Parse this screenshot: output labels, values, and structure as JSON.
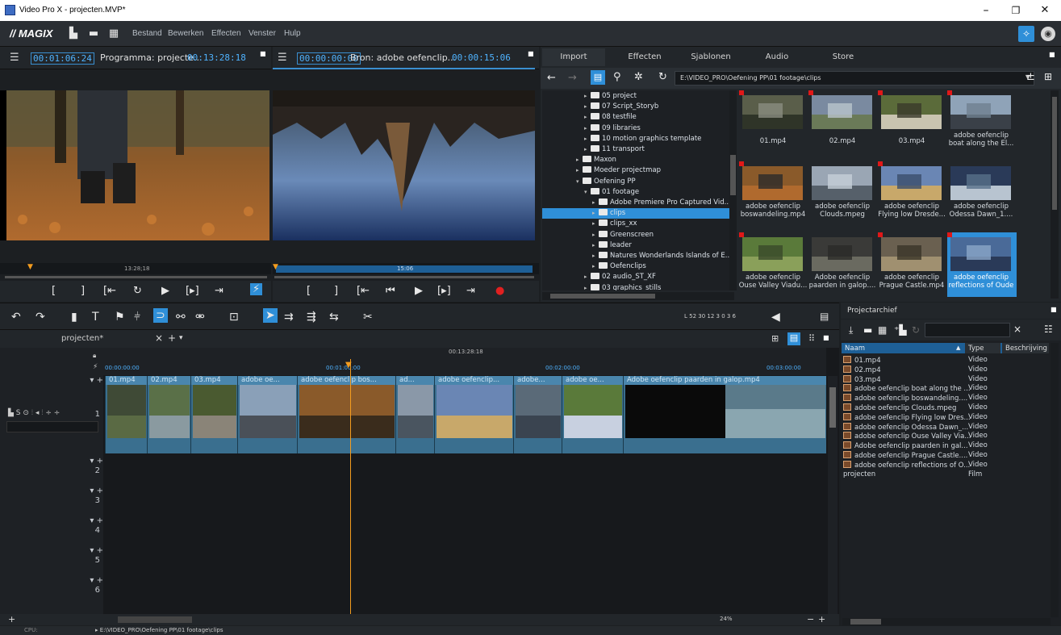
{
  "window": {
    "title": "Video Pro X - projecten.MVP*",
    "minimize": "–",
    "maximize": "❐",
    "close": "✕"
  },
  "menubar": {
    "logo": "// MAGIX",
    "items": [
      "Bestand",
      "Bewerken",
      "Effecten",
      "Venster",
      "Hulp"
    ]
  },
  "program_monitor": {
    "timecode_left": "00:01:06:24",
    "title": "Programma: projecte...",
    "timecode_right": "00:13:28:18",
    "ruler_label": "13:28;18"
  },
  "source_monitor": {
    "timecode_left": "00:00:00:00",
    "title": "Bron: adobe oefenclip...",
    "timecode_right": "00:00:15:06",
    "ruler_label": "15:06"
  },
  "media_tabs": [
    "Import",
    "Effecten",
    "Sjablonen",
    "Audio",
    "Store"
  ],
  "media_path": "E:\\VIDEO_PRO\\Oefening PP\\01 footage\\clips",
  "folder_tree": [
    {
      "label": "05 project",
      "indent": 4
    },
    {
      "label": "07 Script_Storyb",
      "indent": 4
    },
    {
      "label": "08 testfile",
      "indent": 4
    },
    {
      "label": "09 libraries",
      "indent": 4
    },
    {
      "label": "10 motion graphics template",
      "indent": 4
    },
    {
      "label": "11 transport",
      "indent": 4
    },
    {
      "label": "Maxon",
      "indent": 3
    },
    {
      "label": "Moeder projectmap",
      "indent": 3
    },
    {
      "label": "Oefening PP",
      "indent": 3
    },
    {
      "label": "01 footage",
      "indent": 4
    },
    {
      "label": "Adobe Premiere Pro Captured Vid...",
      "indent": 5
    },
    {
      "label": "clips",
      "indent": 5,
      "selected": true
    },
    {
      "label": "clips_xx",
      "indent": 5
    },
    {
      "label": "Greenscreen",
      "indent": 5
    },
    {
      "label": "leader",
      "indent": 5
    },
    {
      "label": "Natures Wonderlands Islands of E...",
      "indent": 5
    },
    {
      "label": "Oefenclips",
      "indent": 5
    },
    {
      "label": "02 audio_ST_XF",
      "indent": 4
    },
    {
      "label": "03 graphics_stills",
      "indent": 4
    }
  ],
  "media_items": [
    {
      "label": "01.mp4"
    },
    {
      "label": "02.mp4"
    },
    {
      "label": "03.mp4"
    },
    {
      "label": "adobe oefenclip boat along the El..."
    },
    {
      "label": "adobe oefenclip boswandeling.mp4"
    },
    {
      "label": "adobe oefenclip Clouds.mpeg"
    },
    {
      "label": "adobe oefenclip Flying low Dresde..."
    },
    {
      "label": "adobe oefenclip Odessa Dawn_1...."
    },
    {
      "label": "adobe oefenclip Ouse Valley Viadu..."
    },
    {
      "label": "Adobe oefenclip paarden in galop...."
    },
    {
      "label": "adobe oefenclip Prague Castle.mp4"
    },
    {
      "label": "adobe oefenclip reflections of Oude"
    }
  ],
  "timeline": {
    "tab": "projecten*",
    "close": "×",
    "add": "+",
    "dropdown": "▾",
    "playhead_tc": "00:13:28:18",
    "ruler": [
      "00:00:00:00",
      "00:01:00:00",
      "00:02:00:00",
      "00:03:00:00"
    ],
    "clips": [
      "01.mp4",
      "02.mp4",
      "03.mp4",
      "adobe oe...",
      "adobe oefenclip bos...",
      "ad...",
      "adobe oefenclip...",
      "adobe...",
      "adobe oe...",
      "Adobe oefenclip paarden in galop.mp4"
    ],
    "tracks": [
      "1",
      "2",
      "3",
      "4",
      "5",
      "6"
    ],
    "zoom": "24%",
    "meter": "L  52  30  12     3  0  3  6"
  },
  "archive": {
    "title": "Projectarchief",
    "columns": [
      "Naam",
      "Type",
      "Beschrijving"
    ],
    "rows": [
      {
        "name": "01.mp4",
        "type": "Video"
      },
      {
        "name": "02.mp4",
        "type": "Video"
      },
      {
        "name": "03.mp4",
        "type": "Video"
      },
      {
        "name": "adobe oefenclip boat along the ...",
        "type": "Video"
      },
      {
        "name": "adobe oefenclip boswandeling....",
        "type": "Video"
      },
      {
        "name": "adobe oefenclip Clouds.mpeg",
        "type": "Video"
      },
      {
        "name": "adobe oefenclip Flying low Dres...",
        "type": "Video"
      },
      {
        "name": "adobe oefenclip Odessa Dawn_...",
        "type": "Video"
      },
      {
        "name": "adobe oefenclip Ouse Valley Via...",
        "type": "Video"
      },
      {
        "name": "Adobe oefenclip paarden in gal...",
        "type": "Video"
      },
      {
        "name": "adobe oefenclip Prague Castle....",
        "type": "Video"
      },
      {
        "name": "adobe oefenclip reflections of O...",
        "type": "Video"
      },
      {
        "name": "projecten",
        "type": "Film"
      }
    ]
  },
  "status": {
    "cpu": "CPU:",
    "path": "▸ E:\\VIDEO_PRO\\Oefening PP\\01 footage\\clips"
  }
}
